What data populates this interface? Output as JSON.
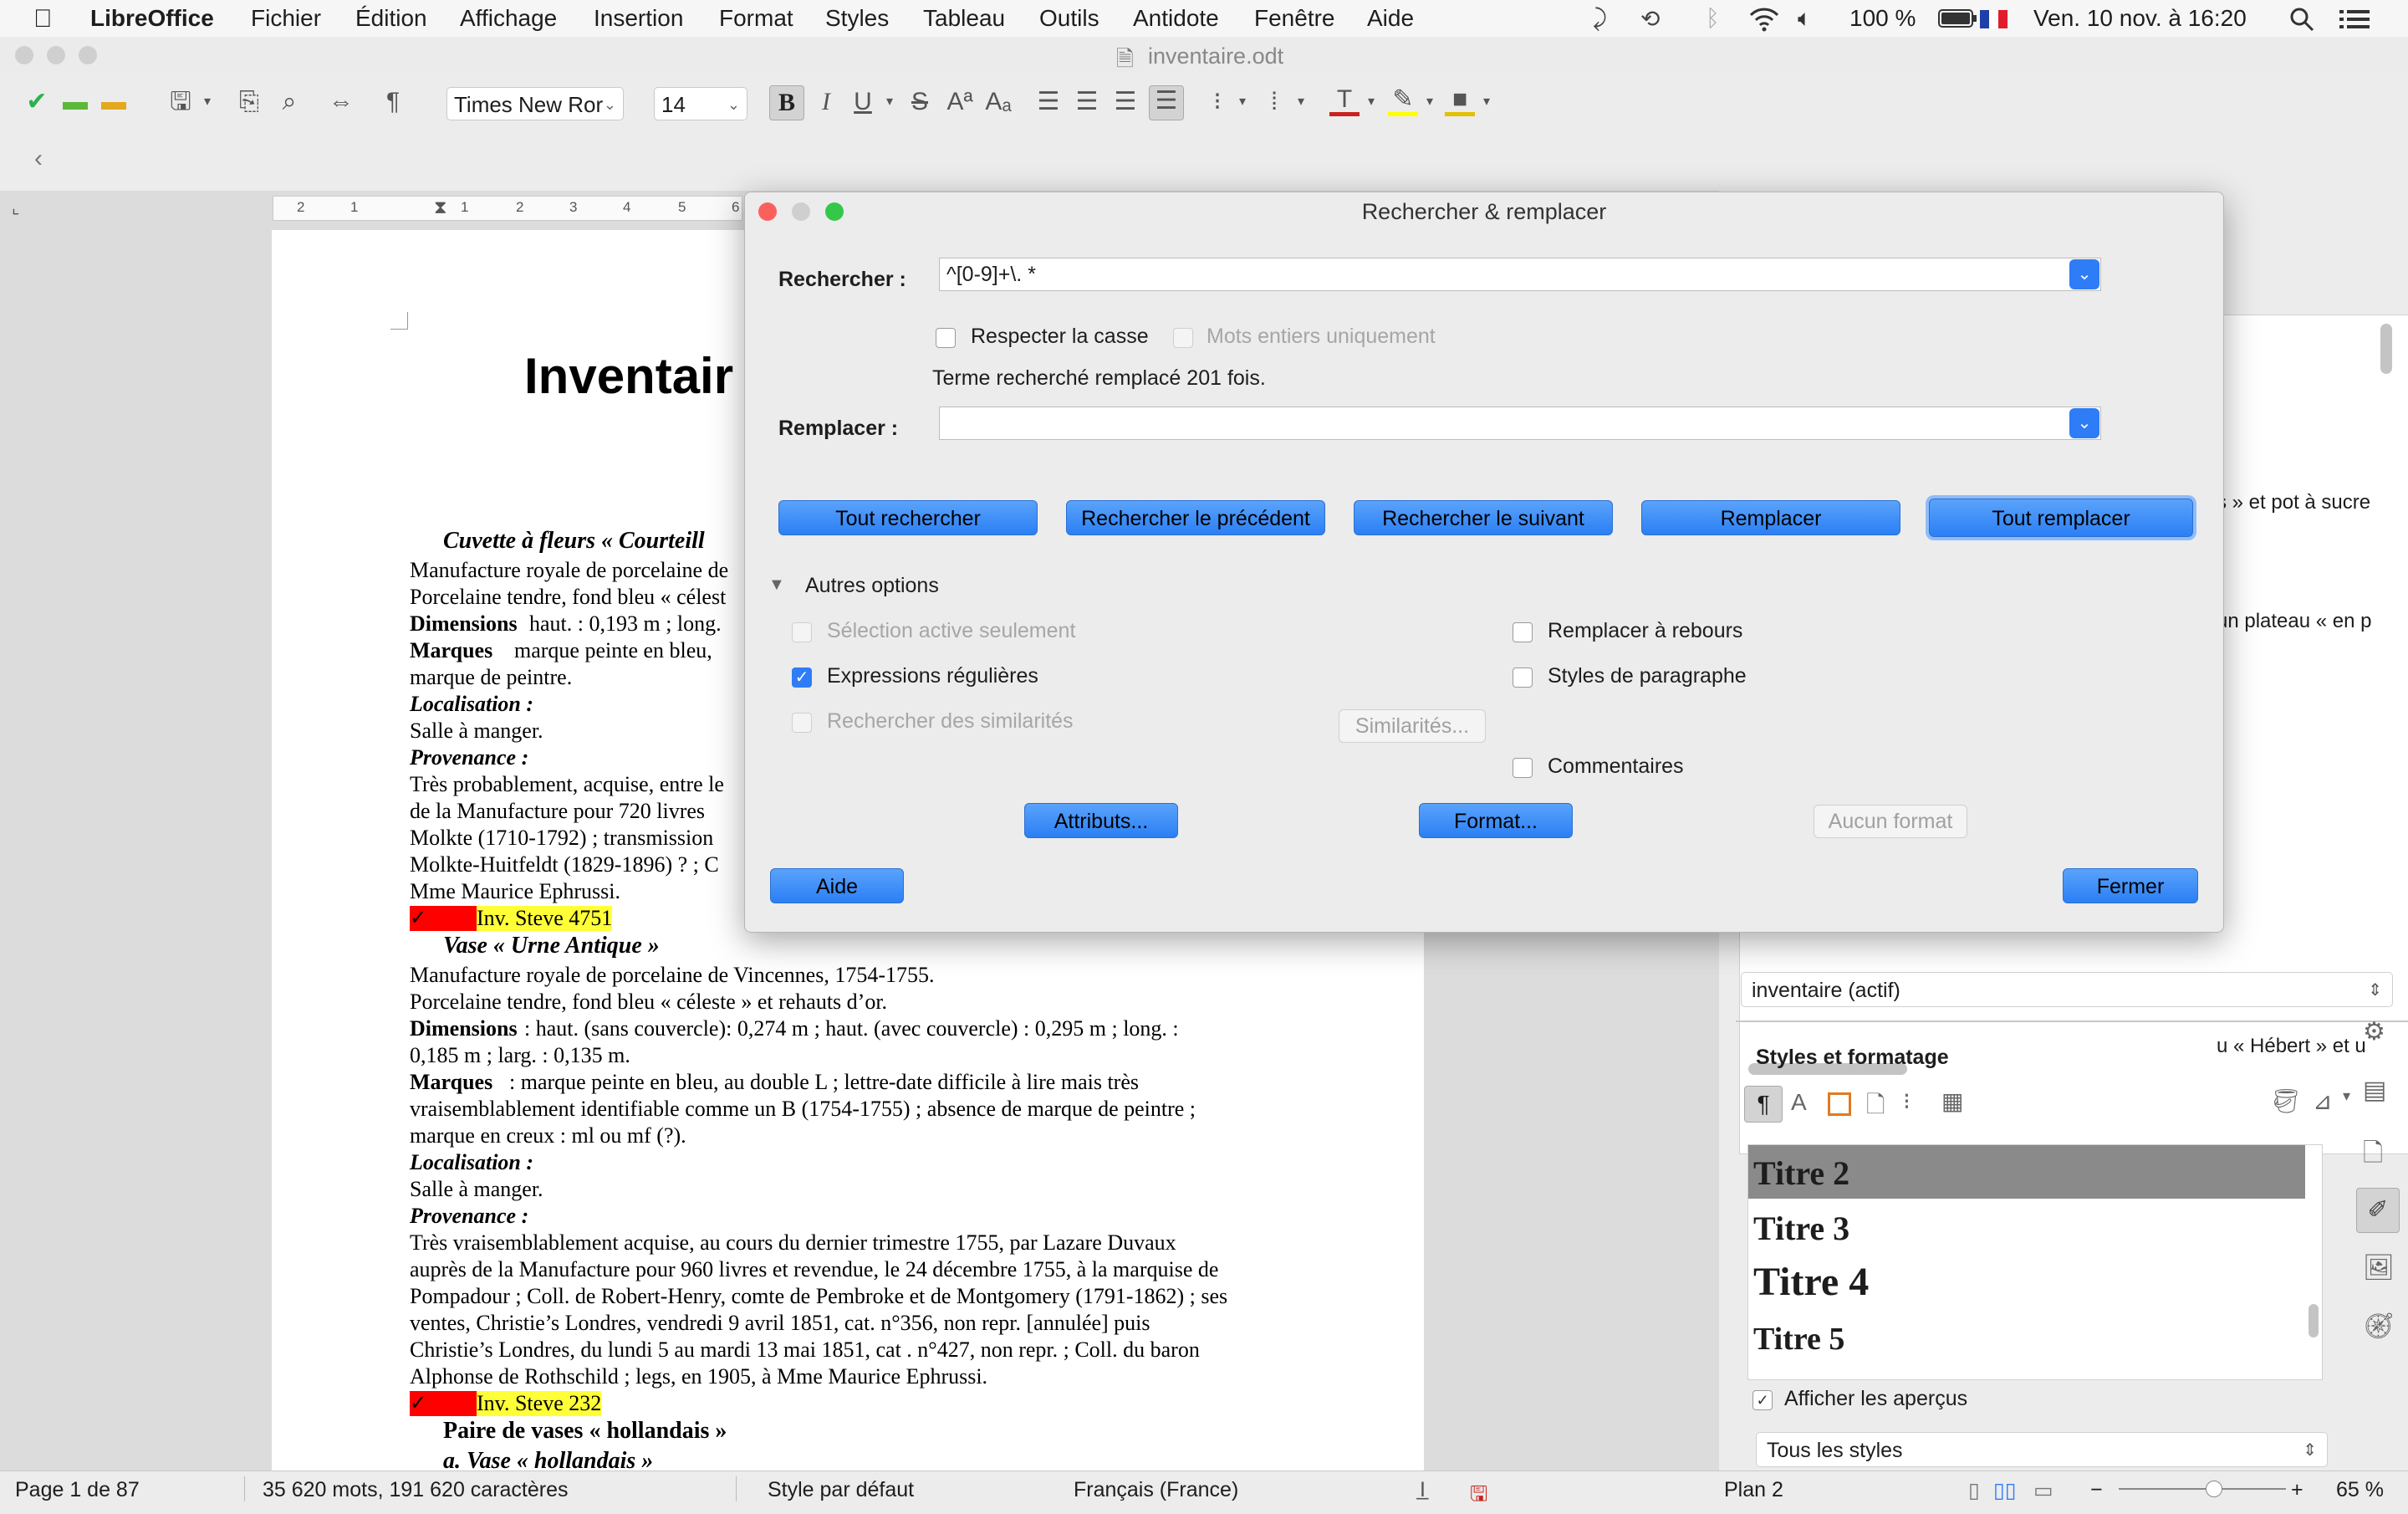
{
  "menubar": {
    "app": "LibreOffice",
    "items": [
      "Fichier",
      "Édition",
      "Affichage",
      "Insertion",
      "Format",
      "Styles",
      "Tableau",
      "Outils",
      "Antidote",
      "Fenêtre",
      "Aide"
    ],
    "battery": "100 %",
    "datetime": "Ven. 10 nov. à 16:20"
  },
  "window": {
    "title": "inventaire.odt"
  },
  "toolbar": {
    "font_name": "Times New Ror",
    "font_size": "14"
  },
  "document": {
    "heading": "Inventair",
    "item1_title": "Cuvette à fleurs « Courteill",
    "item1_lines": [
      "Manufacture royale de porcelaine de",
      "Porcelaine tendre, fond bleu « célest",
      "haut. : 0,193 m ; long.",
      "marque peinte en bleu,",
      "marque de peintre."
    ],
    "dimensions_label": "Dimensions",
    "marques_label": "Marques",
    "localisation_label": "Localisation :",
    "provenance_label": "Provenance :",
    "salle": "Salle à manger.",
    "item1_prov": [
      "Très probablement, acquise, entre le",
      "de la Manufacture pour 720 livres",
      "Molkte (1710-1792) ; transmission",
      "Molkte-Huitfeldt (1829-1896) ? ; C",
      "Mme Maurice Ephrussi."
    ],
    "inv1": "Inv. Steve 4751",
    "item2_title": "Vase « Urne Antique »",
    "item2_lines": [
      "Manufacture royale de porcelaine de Vincennes, 1754-1755.",
      "Porcelaine tendre, fond bleu « céleste » et rehauts d’or.",
      ": haut. (sans couvercle): 0,274 m ; haut. (avec couvercle) : 0,295 m ; long. :",
      "0,185 m ; larg. : 0,135 m.",
      ": marque peinte en bleu, au double L ; lettre-date difficile à lire mais très",
      "vraisemblablement identifiable comme un B (1754-1755) ; absence de marque de peintre ;",
      "marque en creux : ml ou mf (?)."
    ],
    "item2_prov": [
      "Très vraisemblablement acquise, au cours du dernier trimestre 1755, par Lazare Duvaux",
      "auprès de la Manufacture pour 960 livres et revendue, le 24 décembre 1755, à la marquise de",
      "Pompadour ; Coll. de Robert-Henry, comte de Pembroke et de Montgomery (1791-1862) ; ses",
      "ventes, Christie’s Londres, vendredi 9 avril 1851, cat. n°356, non repr. [annulée] puis",
      "Christie’s Londres, du lundi 5 au mardi 13 mai 1851, cat . n°427, non repr. ; Coll. du baron",
      "Alphonse de Rothschild ; legs, en 1905, à Mme Maurice Ephrussi."
    ],
    "inv2": "Inv. Steve 232",
    "item3_title": "Paire de vases « hollandais »",
    "item3_sub": "a. Vase « hollandais »",
    "right_snippets": [
      "s » et pot à sucre",
      "un plateau « en p",
      "u « Hébert » et u"
    ]
  },
  "dialog": {
    "title": "Rechercher & remplacer",
    "search_label": "Rechercher :",
    "search_value": "^[0-9]+\\. *",
    "match_case": "Respecter la casse",
    "whole_words": "Mots entiers uniquement",
    "result_msg": "Terme recherché remplacé 201 fois.",
    "replace_label": "Remplacer :",
    "replace_value": "",
    "buttons": [
      "Tout rechercher",
      "Rechercher le précédent",
      "Rechercher le suivant",
      "Remplacer",
      "Tout remplacer"
    ],
    "other_options": "Autres options",
    "opt_current_selection": "Sélection active seulement",
    "opt_regex": "Expressions régulières",
    "opt_similarity": "Rechercher des similarités",
    "similarity_btn": "Similarités...",
    "opt_backwards": "Remplacer à rebours",
    "opt_para_styles": "Styles de paragraphe",
    "opt_comments": "Commentaires",
    "attributes_btn": "Attributs...",
    "format_btn": "Format...",
    "no_format_btn": "Aucun format",
    "help_btn": "Aide",
    "close_btn": "Fermer",
    "regex_checked": true
  },
  "sidebar": {
    "nav_doc": "inventaire (actif)",
    "styles_title": "Styles et formatage",
    "styles": [
      "Titre 2",
      "Titre 3",
      "Titre 4",
      "Titre 5"
    ],
    "show_previews": "Afficher les aperçus",
    "filter": "Tous les styles"
  },
  "statusbar": {
    "page": "Page 1 de 87",
    "words": "35 620 mots, 191 620 caractères",
    "style": "Style par défaut",
    "language": "Français (France)",
    "outline": "Plan 2",
    "zoom": "65 %"
  }
}
